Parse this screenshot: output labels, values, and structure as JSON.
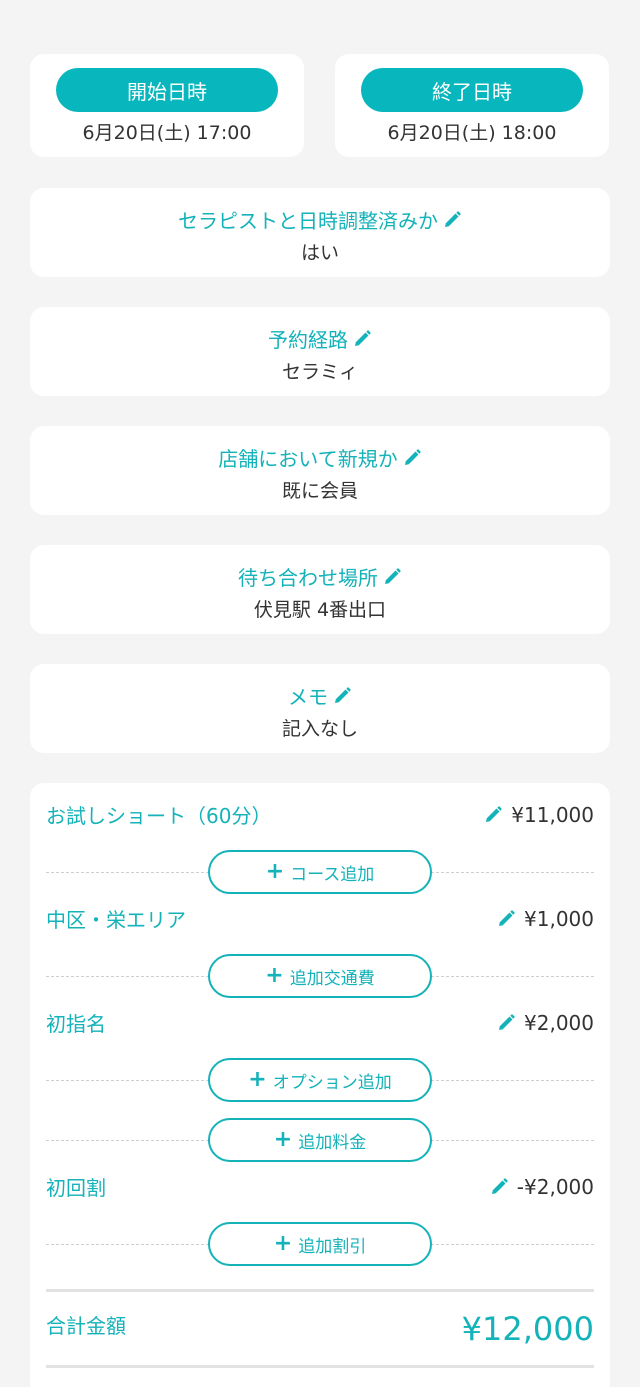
{
  "schedule": {
    "start_label": "開始日時",
    "start_value": "6月20日(土) 17:00",
    "end_label": "終了日時",
    "end_value": "6月20日(土) 18:00"
  },
  "info": [
    {
      "label": "セラピストと日時調整済みか",
      "value": "はい"
    },
    {
      "label": "予約経路",
      "value": "セラミィ"
    },
    {
      "label": "店舗において新規か",
      "value": "既に会員"
    },
    {
      "label": "待ち合わせ場所",
      "value": "伏見駅 4番出口"
    },
    {
      "label": "メモ",
      "value": "記入なし"
    }
  ],
  "billing": {
    "course": {
      "name": "お試しショート（60分）",
      "price": "¥11,000"
    },
    "add_course": "コース追加",
    "transport": {
      "name": "中区・栄エリア",
      "price": "¥1,000"
    },
    "add_transport": "追加交通費",
    "nomination": {
      "name": "初指名",
      "price": "¥2,000"
    },
    "add_option": "オプション追加",
    "add_fee": "追加料金",
    "discount": {
      "name": "初回割",
      "price": "-¥2,000"
    },
    "add_discount": "追加割引",
    "total_label": "合計金額",
    "total_value": "¥12,000"
  },
  "icons": {
    "edit": "pencil-icon",
    "add": "plus-icon"
  },
  "colors": {
    "accent": "#14b2b9",
    "background": "#f4f4f4"
  }
}
